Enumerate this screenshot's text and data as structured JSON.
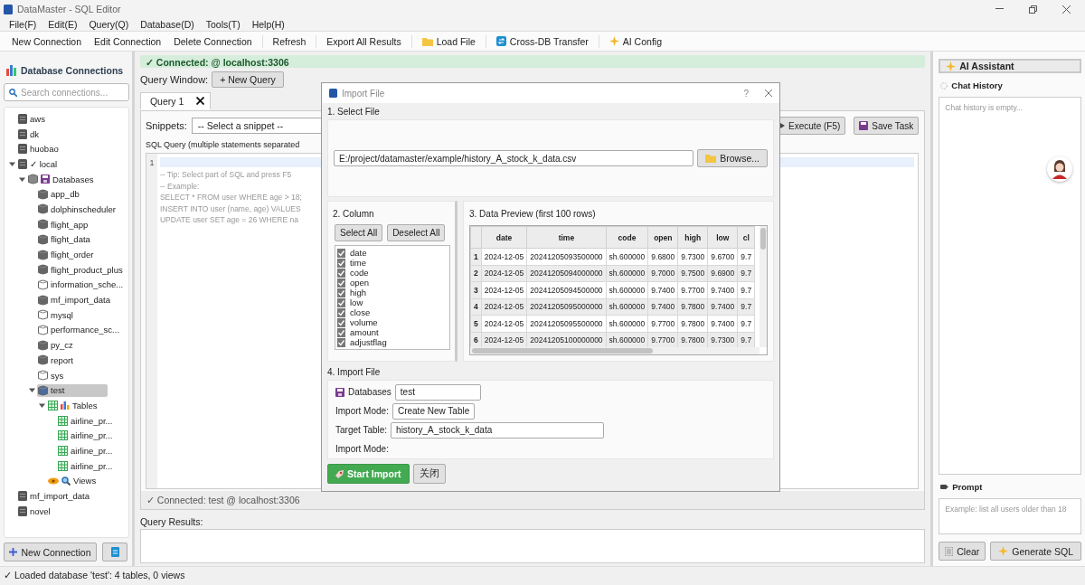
{
  "window": {
    "title": "DataMaster - SQL Editor"
  },
  "menu": [
    "File(F)",
    "Edit(E)",
    "Query(Q)",
    "Database(D)",
    "Tools(T)",
    "Help(H)"
  ],
  "toolbar": [
    {
      "label": "New Connection",
      "kind": "text"
    },
    {
      "label": "Edit Connection",
      "kind": "text"
    },
    {
      "label": "Delete Connection",
      "kind": "text"
    },
    {
      "label": "Refresh",
      "kind": "text"
    },
    {
      "label": "Export All Results",
      "kind": "text"
    },
    {
      "label": "Load File",
      "kind": "folder"
    },
    {
      "label": "Cross-DB Transfer",
      "kind": "transfer"
    },
    {
      "label": "AI Config",
      "kind": "sparkle"
    }
  ],
  "sidebar": {
    "title": "Database Connections",
    "search": {
      "placeholder": "Search connections..."
    },
    "tree": [
      {
        "label": "aws",
        "kind": "server",
        "selected": false
      },
      {
        "label": "dk",
        "kind": "server",
        "selected": false
      },
      {
        "label": "huobao",
        "kind": "server",
        "selected": false
      },
      {
        "label": "✓ local",
        "kind": "server",
        "selected": false,
        "expanded": true,
        "children": [
          {
            "label": "Databases",
            "kind": "databases_folder",
            "selected": false,
            "expanded": true,
            "children": [
              {
                "label": "app_db",
                "kind": "database",
                "selected": false
              },
              {
                "label": "dolphinscheduler",
                "kind": "database",
                "selected": false
              },
              {
                "label": "flight_app",
                "kind": "database",
                "selected": false
              },
              {
                "label": "flight_data",
                "kind": "database",
                "selected": false
              },
              {
                "label": "flight_order",
                "kind": "database",
                "selected": false
              },
              {
                "label": "flight_product_plus",
                "kind": "database",
                "selected": false
              },
              {
                "label": "information_sche...",
                "kind": "system_database",
                "selected": false
              },
              {
                "label": "mf_import_data",
                "kind": "database",
                "selected": false
              },
              {
                "label": "mysql",
                "kind": "system_database",
                "selected": false
              },
              {
                "label": "performance_sc...",
                "kind": "system_database",
                "selected": false
              },
              {
                "label": "py_cz",
                "kind": "database",
                "selected": false
              },
              {
                "label": "report",
                "kind": "database",
                "selected": false
              },
              {
                "label": "sys",
                "kind": "system_database",
                "selected": false
              },
              {
                "label": "test",
                "kind": "database",
                "selected": true,
                "expanded": true,
                "children": [
                  {
                    "label": "Tables",
                    "kind": "tables_folder",
                    "selected": false,
                    "expanded": true,
                    "children": [
                      {
                        "label": "airline_pr...",
                        "kind": "table",
                        "selected": false
                      },
                      {
                        "label": "airline_pr...",
                        "kind": "table",
                        "selected": false
                      },
                      {
                        "label": "airline_pr...",
                        "kind": "table",
                        "selected": false
                      },
                      {
                        "label": "airline_pr...",
                        "kind": "table",
                        "selected": false
                      }
                    ]
                  },
                  {
                    "label": "Views",
                    "kind": "views_folder",
                    "selected": false
                  }
                ]
              }
            ]
          }
        ]
      },
      {
        "label": "mf_import_data",
        "kind": "server",
        "selected": false
      },
      {
        "label": "novel",
        "kind": "server",
        "selected": false
      }
    ],
    "new_connection_button": "New Connection"
  },
  "connection_banner": "✓ Connected:  @ localhost:3306",
  "query_window": {
    "label": "Query Window:",
    "new_query_button": "+ New Query"
  },
  "tabs": [
    {
      "label": "Query 1",
      "selected": true
    }
  ],
  "editor": {
    "snippets_label": "Snippets:",
    "snippet_select": "-- Select a snippet --",
    "buttons": [
      {
        "label": "Execute (F5)",
        "kind": "play"
      },
      {
        "label": "Save Task",
        "kind": "save"
      }
    ],
    "sql_label": "SQL Query (multiple statements separated",
    "line_numbers": [
      "1"
    ],
    "lines": [
      "-- Tip: Select part of SQL and press F5",
      "-- Example:",
      "SELECT * FROM user WHERE age > 18;",
      "INSERT INTO user (name, age) VALUES",
      "UPDATE user SET age = 26 WHERE na"
    ],
    "status": "✓ Connected: test @ localhost:3306"
  },
  "results": {
    "label": "Query Results:"
  },
  "ai_panel": {
    "title": "AI Assistant",
    "history_label": "Chat History",
    "history_placeholder": "Chat history is empty...",
    "prompt_label": "Prompt",
    "prompt_placeholder": "Example: list all users older than 18",
    "buttons": [
      {
        "label": "Clear",
        "kind": "clear"
      },
      {
        "label": "Generate SQL",
        "kind": "sparkle"
      }
    ]
  },
  "dialog": {
    "title": "Import File",
    "help": "?",
    "select_file": {
      "heading": "1. Select File",
      "path": "E:/project/datamaster/example/history_A_stock_k_data.csv",
      "browse_button": "Browse..."
    },
    "columns": {
      "heading": "2. Column",
      "buttons": [
        "Select All",
        "Deselect All"
      ],
      "items": [
        {
          "label": "date",
          "checked": true
        },
        {
          "label": "time",
          "checked": true
        },
        {
          "label": "code",
          "checked": true
        },
        {
          "label": "open",
          "checked": true
        },
        {
          "label": "high",
          "checked": true
        },
        {
          "label": "low",
          "checked": true
        },
        {
          "label": "close",
          "checked": true
        },
        {
          "label": "volume",
          "checked": true
        },
        {
          "label": "amount",
          "checked": true
        },
        {
          "label": "adjustflag",
          "checked": true
        }
      ]
    },
    "preview": {
      "heading": "3. Data Preview (first 100 rows)",
      "columns": [
        "date",
        "time",
        "code",
        "open",
        "high",
        "low",
        "cl"
      ],
      "rows": [
        {
          "number": "1",
          "cells": [
            "2024-12-05",
            "20241205093500000",
            "sh.600000",
            "9.6800",
            "9.7300",
            "9.6700",
            "9.7"
          ]
        },
        {
          "number": "2",
          "cells": [
            "2024-12-05",
            "20241205094000000",
            "sh.600000",
            "9.7000",
            "9.7500",
            "9.6900",
            "9.7"
          ]
        },
        {
          "number": "3",
          "cells": [
            "2024-12-05",
            "20241205094500000",
            "sh.600000",
            "9.7400",
            "9.7700",
            "9.7400",
            "9.7"
          ]
        },
        {
          "number": "4",
          "cells": [
            "2024-12-05",
            "20241205095000000",
            "sh.600000",
            "9.7400",
            "9.7800",
            "9.7400",
            "9.7"
          ]
        },
        {
          "number": "5",
          "cells": [
            "2024-12-05",
            "20241205095500000",
            "sh.600000",
            "9.7700",
            "9.7800",
            "9.7400",
            "9.7"
          ]
        },
        {
          "number": "6",
          "cells": [
            "2024-12-05",
            "20241205100000000",
            "sh.600000",
            "9.7700",
            "9.7800",
            "9.7300",
            "9.7"
          ]
        }
      ]
    },
    "import": {
      "heading": "4. Import File",
      "fields": [
        {
          "label": "Databases",
          "value": "test",
          "kind": "database"
        },
        {
          "label": "Import Mode:",
          "value": "Create New Table",
          "kind": "mode"
        },
        {
          "label": "Target Table:",
          "value": "history_A_stock_k_data",
          "kind": "table"
        },
        {
          "label": "Import Mode:",
          "kind": "empty"
        }
      ]
    },
    "buttons": [
      {
        "label": "Start Import",
        "kind": "primary"
      },
      {
        "label": "关闭",
        "kind": "secondary"
      }
    ]
  },
  "status_bar": "✓ Loaded database 'test': 4 tables, 0 views"
}
